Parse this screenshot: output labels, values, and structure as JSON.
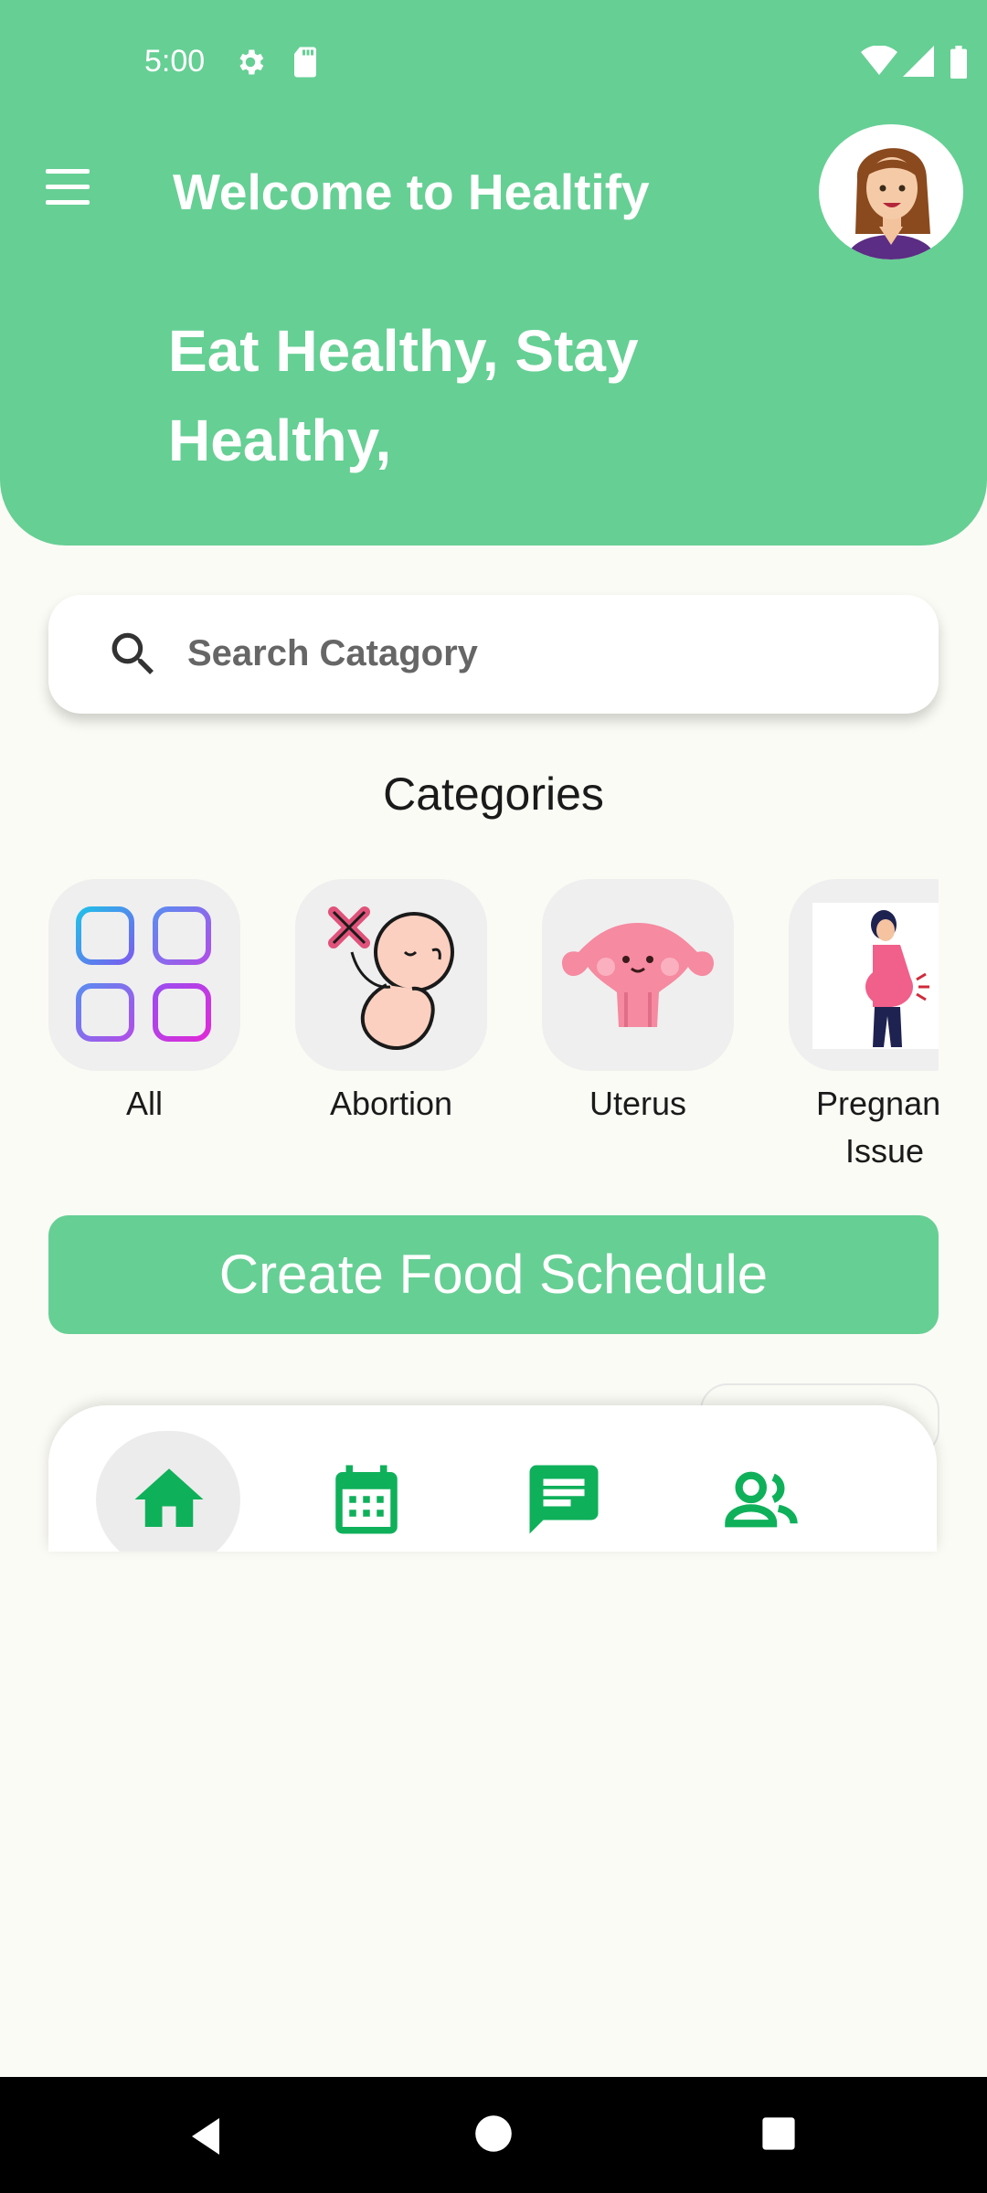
{
  "status_bar": {
    "time": "5:00"
  },
  "header": {
    "title": "Welcome to Healtify",
    "tagline": "Eat Healthy, Stay Healthy,"
  },
  "search": {
    "placeholder": "Search Catagory"
  },
  "categories": {
    "title": "Categories",
    "items": [
      {
        "label": "All",
        "icon": "grid-icon"
      },
      {
        "label": "Abortion",
        "icon": "fetus-icon"
      },
      {
        "label": "Uterus",
        "icon": "uterus-icon"
      },
      {
        "label": "Pregnancy Issue",
        "icon": "pregnant-woman-icon"
      }
    ]
  },
  "cta": {
    "label": "Create Food Schedule"
  },
  "bottom_nav": {
    "items": [
      {
        "icon": "home-icon",
        "active": true
      },
      {
        "icon": "calendar-icon"
      },
      {
        "icon": "chat-icon"
      },
      {
        "icon": "people-icon"
      }
    ]
  },
  "colors": {
    "primary": "#66cf94",
    "icon_green": "#0fb05a",
    "background": "#fbfbf5"
  }
}
